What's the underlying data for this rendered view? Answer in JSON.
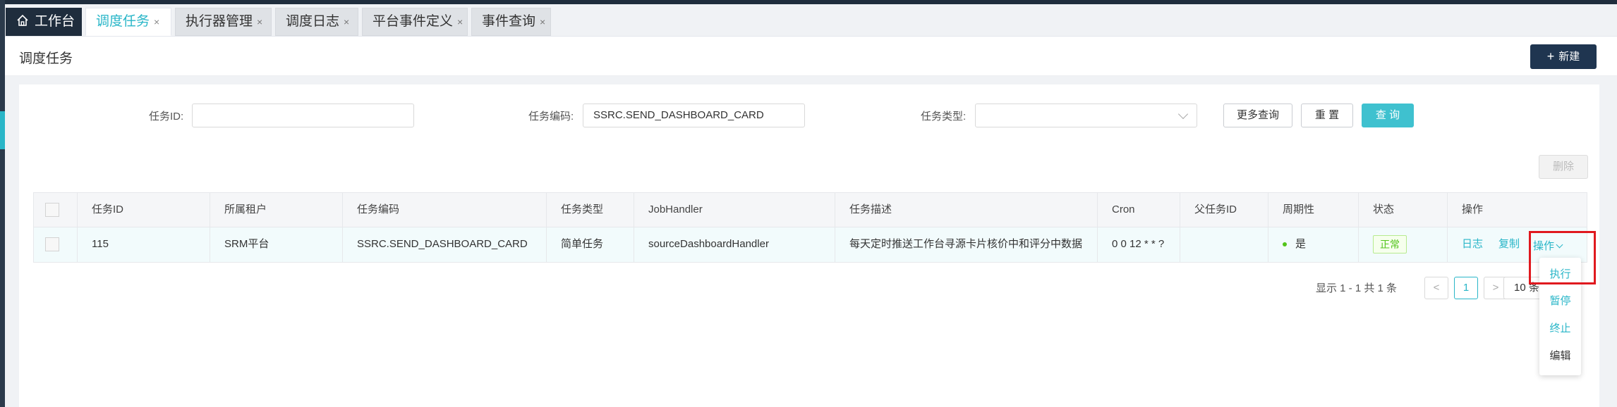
{
  "tabs": [
    {
      "label": "工作台",
      "home": true
    },
    {
      "label": "调度任务",
      "active": true,
      "close": "×"
    },
    {
      "label": "执行器管理",
      "close": "×"
    },
    {
      "label": "调度日志",
      "close": "×"
    },
    {
      "label": "平台事件定义",
      "close": "×"
    },
    {
      "label": "事件查询",
      "close": "×"
    }
  ],
  "header": {
    "title": "调度任务",
    "new_label": "新建",
    "new_icon": "plus-icon"
  },
  "filters": {
    "task_id_label": "任务ID:",
    "task_id_value": "",
    "task_code_label": "任务编码:",
    "task_code_value": "SSRC.SEND_DASHBOARD_CARD",
    "task_type_label": "任务类型:",
    "task_type_value": "",
    "more_label": "更多查询",
    "reset_label": "重 置",
    "query_label": "查 询",
    "delete_label": "删除"
  },
  "table": {
    "headers": [
      "任务ID",
      "所属租户",
      "任务编码",
      "任务类型",
      "JobHandler",
      "任务描述",
      "Cron",
      "父任务ID",
      "周期性",
      "状态",
      "操作"
    ],
    "rows": [
      {
        "id": "115",
        "tenant": "SRM平台",
        "code": "SSRC.SEND_DASHBOARD_CARD",
        "type": "简单任务",
        "handler": "sourceDashboardHandler",
        "desc": "每天定时推送工作台寻源卡片核价中和评分中数据",
        "cron": "0 0 12 * * ?",
        "parent": "",
        "periodic": "是",
        "status": "正常",
        "log_label": "日志",
        "copy_label": "复制",
        "ops_label": "操作"
      }
    ]
  },
  "pagination": {
    "summary": "显示 1 - 1 共 1 条",
    "current_page": "1",
    "page_size": "10 条",
    "prev": "<",
    "next": ">"
  },
  "ops_menu": [
    "执行",
    "暂停",
    "终止",
    "编辑"
  ],
  "colors": {
    "accent": "#29b6c8",
    "dark": "#1f2d3d",
    "highlight": "#e0191f",
    "status_green": "#52c41a"
  }
}
